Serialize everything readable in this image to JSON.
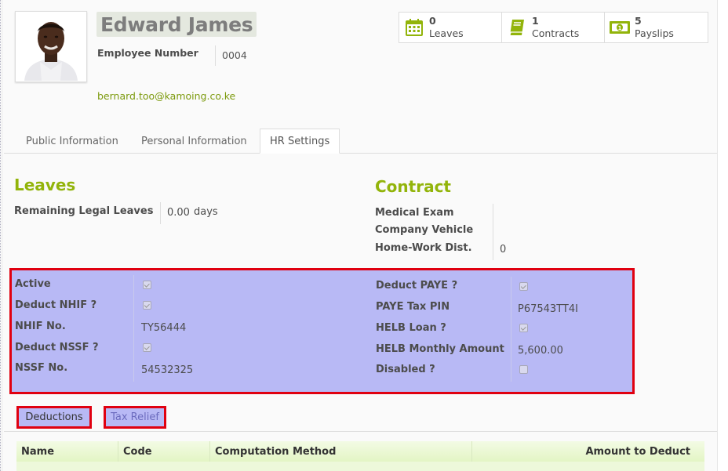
{
  "employee": {
    "name": "Edward James",
    "employee_number_label": "Employee Number",
    "employee_number": "0004",
    "email": "bernard.too@kamoing.co.ke"
  },
  "stats": [
    {
      "count": "0",
      "label": "Leaves",
      "icon": "calendar-icon"
    },
    {
      "count": "1",
      "label": "Contracts",
      "icon": "book-icon"
    },
    {
      "count": "5",
      "label": "Payslips",
      "icon": "money-icon"
    }
  ],
  "tabs": [
    "Public Information",
    "Personal Information",
    "HR Settings"
  ],
  "leaves": {
    "title": "Leaves",
    "remaining_label": "Remaining Legal Leaves",
    "remaining_value": "0.00",
    "remaining_unit": "days"
  },
  "contract": {
    "title": "Contract",
    "medical_exam_label": "Medical Exam",
    "company_vehicle_label": "Company Vehicle",
    "home_work_label": "Home-Work Dist.",
    "home_work_value": "0"
  },
  "deductions_left": {
    "active_label": "Active",
    "active_checked": true,
    "deduct_nhif_label": "Deduct NHIF ?",
    "deduct_nhif_checked": true,
    "nhif_no_label": "NHIF No.",
    "nhif_no": "TY56444",
    "deduct_nssf_label": "Deduct NSSF ?",
    "deduct_nssf_checked": true,
    "nssf_no_label": "NSSF No.",
    "nssf_no": "54532325"
  },
  "deductions_right": {
    "deduct_paye_label": "Deduct PAYE ?",
    "deduct_paye_checked": true,
    "paye_pin_label": "PAYE Tax PIN",
    "paye_pin": "P67543TT4I",
    "helb_loan_label": "HELB Loan ?",
    "helb_loan_checked": true,
    "helb_amount_label": "HELB Monthly Amount",
    "helb_amount": "5,600.00",
    "disabled_label": "Disabled ?",
    "disabled_checked": false
  },
  "bottom_tabs": [
    "Deductions",
    "Tax Relief"
  ],
  "table": {
    "columns": [
      "Name",
      "Code",
      "Computation Method",
      "Amount to Deduct"
    ]
  },
  "colors": {
    "accent": "#92b40a",
    "highlight_fill": "#b8b9f5",
    "highlight_border": "#e00010"
  }
}
